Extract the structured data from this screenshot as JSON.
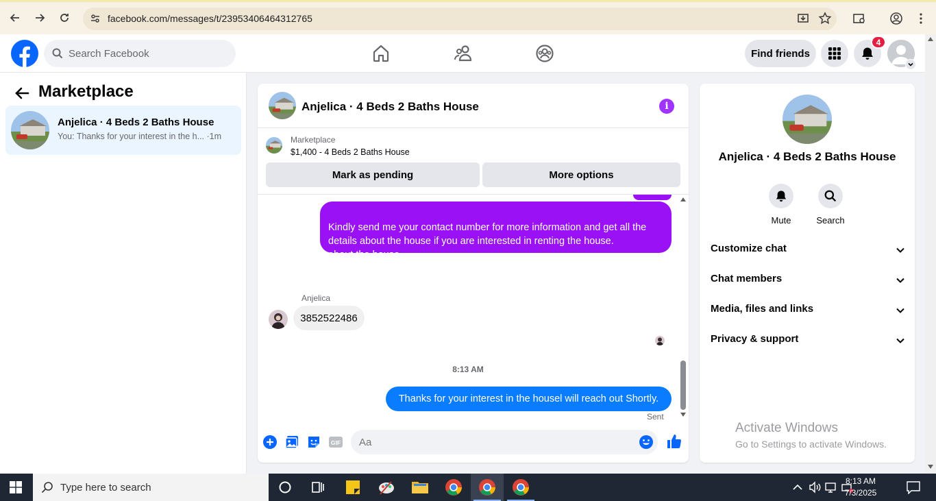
{
  "browser": {
    "url": "facebook.com/messages/t/23953406464312765"
  },
  "header": {
    "search_placeholder": "Search Facebook",
    "find_friends_label": "Find friends",
    "notification_count": "4"
  },
  "left_panel": {
    "title": "Marketplace",
    "conversations": [
      {
        "name": "Anjelica · 4 Beds 2 Baths House",
        "preview": "You: Thanks for your interest in the h... ·1m"
      }
    ]
  },
  "chat": {
    "title": "Anjelica · 4 Beds 2 Baths House",
    "marketplace_label": "Marketplace",
    "listing": "$1,400 - 4 Beds 2 Baths House",
    "mark_pending_label": "Mark as pending",
    "more_options_label": "More options",
    "messages": {
      "outgoing_1": "Kindly send me your contact number for more information and get all the details about the house if you are interested in renting the house.\nabout the house.",
      "sender_name": "Anjelica",
      "incoming_1": "3852522486",
      "time": "8:13 AM",
      "outgoing_2": "Thanks for your interest in the housel will reach out Shortly.",
      "status": "Sent"
    },
    "compose_placeholder": "Aa"
  },
  "right_panel": {
    "name": "Anjelica · 4 Beds 2 Baths House",
    "mute_label": "Mute",
    "search_label": "Search",
    "sections": [
      "Customize chat",
      "Chat members",
      "Media, files and links",
      "Privacy & support"
    ],
    "watermark_title": "Activate Windows",
    "watermark_sub": "Go to Settings to activate Windows."
  },
  "taskbar": {
    "search_placeholder": "Type here to search",
    "time": "8:13 AM",
    "date": "7/3/2025"
  },
  "colors": {
    "fb_blue": "#0866ff",
    "purple_bubble": "#9b11f5",
    "blue_bubble": "#0a7cff",
    "badge_red": "#e41e3f"
  }
}
